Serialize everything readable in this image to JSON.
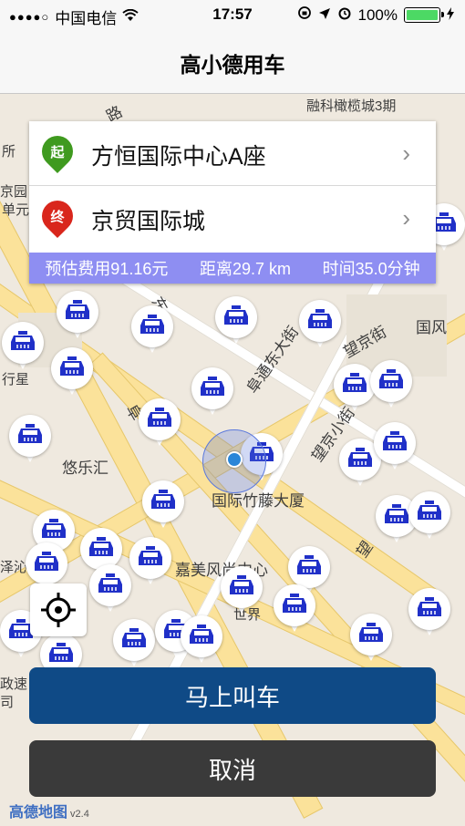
{
  "status_bar": {
    "signal": "●●●●○",
    "carrier": "中国电信",
    "time": "17:57",
    "battery": "100%"
  },
  "nav": {
    "title": "高小德用车"
  },
  "route": {
    "start_badge": "起",
    "start_place": "方恒国际中心A座",
    "end_badge": "终",
    "end_place": "京贸国际城",
    "fare": "预估费用91.16元",
    "distance": "距离29.7 km",
    "duration": "时间35.0分钟"
  },
  "map": {
    "labels": {
      "top_building": "融科橄榄城3期",
      "west_top": "所",
      "west_school": "京园",
      "unit": "单元",
      "road_top": "路",
      "street_east": "阜通东大街",
      "street_jing": "望京街",
      "guofeng": "国风",
      "xingji": "行星",
      "youlehui": "悠乐汇",
      "street_xiao": "望京小街",
      "hotel": "国际竹藤大厦",
      "jiamei": "嘉美风尚中心",
      "hui": "汇",
      "west_mid": "泽沁",
      "west_bottom1": "政速",
      "west_bottom2": "司",
      "street_fu": "阜",
      "street_dong": "东",
      "wang": "望",
      "beautiful": "世界"
    },
    "logo": "高德地图",
    "logo_version": "v2.4"
  },
  "buttons": {
    "call": "马上叫车",
    "cancel": "取消"
  },
  "colors": {
    "taxi": "#2030c8",
    "call_button": "#0f4a86",
    "cancel_button": "#3a3a3a",
    "summary_bar": "#8e8ef2"
  }
}
